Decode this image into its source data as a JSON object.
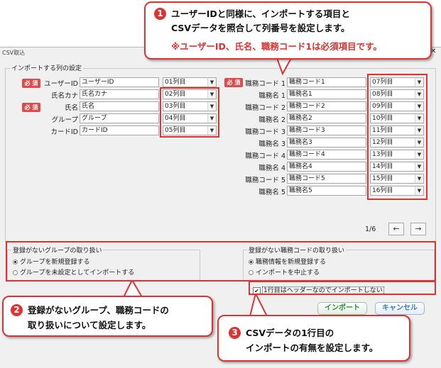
{
  "window": {
    "title": "CSV取込"
  },
  "column_settings": {
    "group_label": "インポートする列の設定",
    "required_badge": "必 須",
    "left_fields": [
      {
        "label": "ユーザーID",
        "field": "ユーザーID",
        "column": "01列目",
        "required": true
      },
      {
        "label": "氏名カナ",
        "field": "氏名カナ",
        "column": "02列目",
        "required": false
      },
      {
        "label": "氏名",
        "field": "氏名",
        "column": "03列目",
        "required": true
      },
      {
        "label": "グループ",
        "field": "グループ",
        "column": "04列目",
        "required": false
      },
      {
        "label": "カードID",
        "field": "カードID",
        "column": "05列目",
        "required": false
      }
    ],
    "right_fields": [
      {
        "label": "職務コード 1",
        "field": "職務コード1",
        "column": "07列目",
        "required": true
      },
      {
        "label": "職務名 1",
        "field": "職務名1",
        "column": "08列目"
      },
      {
        "label": "職務コード 2",
        "field": "職務コード2",
        "column": "09列目"
      },
      {
        "label": "職務名 2",
        "field": "職務名2",
        "column": "10列目"
      },
      {
        "label": "職務コード 3",
        "field": "職務コード3",
        "column": "11列目"
      },
      {
        "label": "職務名 3",
        "field": "職務名3",
        "column": "12列目"
      },
      {
        "label": "職務コード 4",
        "field": "職務コード4",
        "column": "13列目"
      },
      {
        "label": "職務名 4",
        "field": "職務名4",
        "column": "14列目"
      },
      {
        "label": "職務コード 5",
        "field": "職務コード5",
        "column": "15列目"
      },
      {
        "label": "職務名 5",
        "field": "職務名5",
        "column": "16列目"
      }
    ],
    "pagination": "1/6",
    "prev_icon": "←",
    "next_icon": "→"
  },
  "unregistered_group": {
    "label": "登録がないグループの取り扱い",
    "options": [
      {
        "text": "グループを新規登録する",
        "selected": true
      },
      {
        "text": "グループを未設定としてインポートする",
        "selected": false
      }
    ]
  },
  "unregistered_job": {
    "label": "登録がない職務コードの取り扱い",
    "options": [
      {
        "text": "職務情報を新規登録する",
        "selected": true
      },
      {
        "text": "インポートを中止する",
        "selected": false
      }
    ]
  },
  "header_checkbox": {
    "label": "1行目はヘッダーなのでインポートしない",
    "checked": true
  },
  "buttons": {
    "import": "インポート",
    "cancel": "キャンセル"
  },
  "callouts": {
    "c1": {
      "num": "1",
      "line1": "ユーザーIDと同様に、インポートする項目と",
      "line2": "CSVデータを照合して列番号を設定します。",
      "line3": "※ユーザーID、氏名、職務コード1は必須項目です。"
    },
    "c2": {
      "num": "2",
      "line1": "登録がないグループ、職務コードの",
      "line2": "取り扱いについて設定します。"
    },
    "c3": {
      "num": "3",
      "line1": "CSVデータの1行目の",
      "line2": "インポートの有無を設定します。"
    }
  },
  "colors": {
    "accent_red": "#e03232",
    "required_badge": "#e04a4a",
    "import_text": "#2e8b3a",
    "cancel_text": "#3a7bbf"
  }
}
